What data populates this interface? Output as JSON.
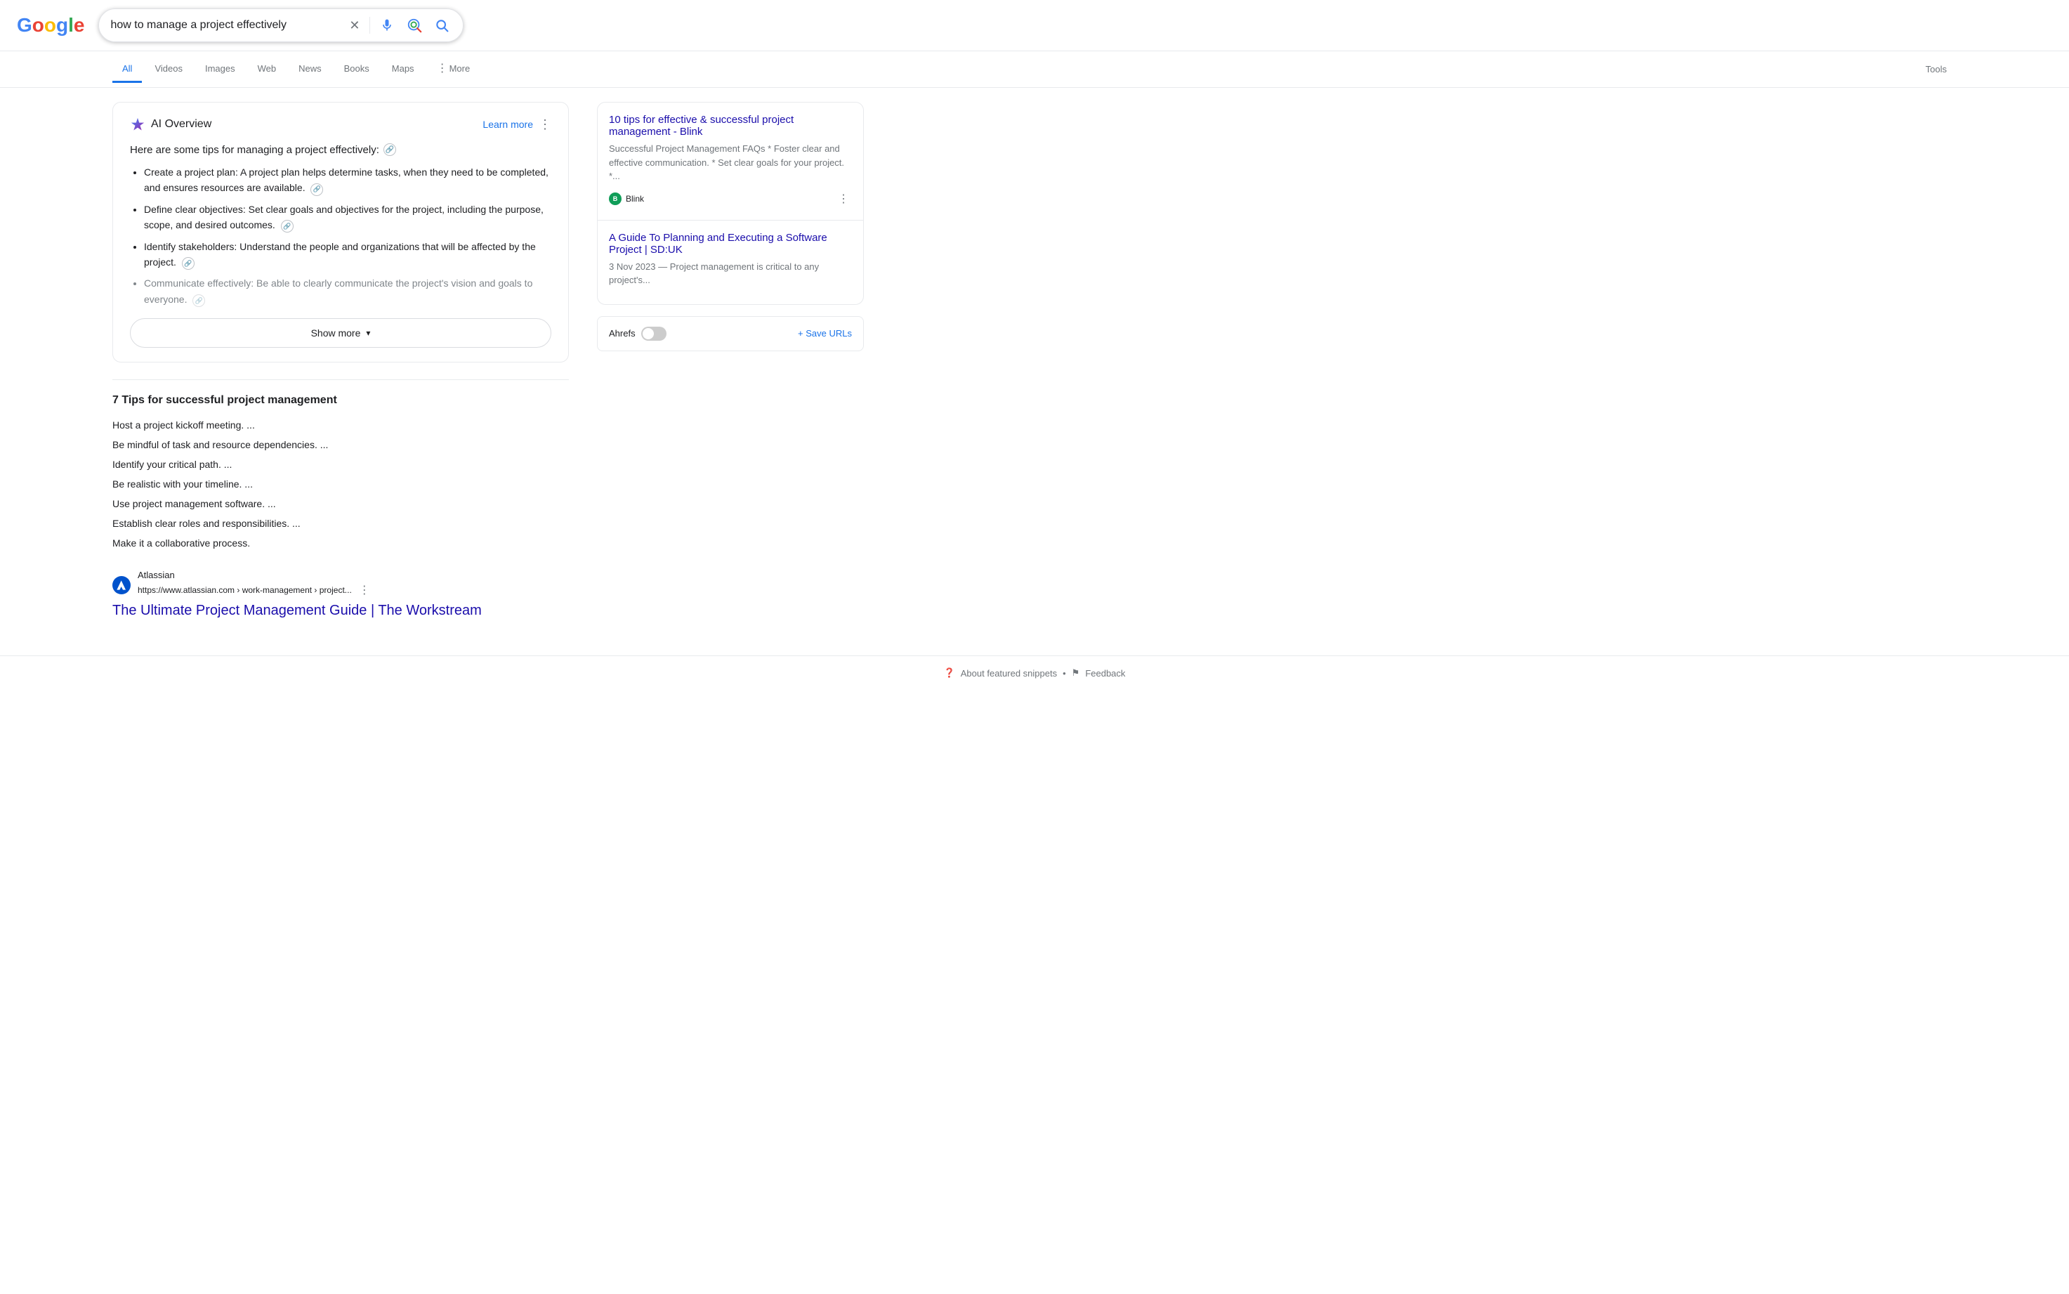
{
  "header": {
    "logo_letters": [
      "G",
      "o",
      "o",
      "g",
      "l",
      "e"
    ],
    "search_value": "how to manage a project effectively",
    "clear_title": "Clear",
    "mic_title": "Search by voice",
    "lens_title": "Search by image",
    "search_title": "Google Search"
  },
  "nav": {
    "tabs": [
      {
        "label": "All",
        "active": true
      },
      {
        "label": "Videos",
        "active": false
      },
      {
        "label": "Images",
        "active": false
      },
      {
        "label": "Web",
        "active": false
      },
      {
        "label": "News",
        "active": false
      },
      {
        "label": "Books",
        "active": false
      },
      {
        "label": "Maps",
        "active": false
      },
      {
        "label": "More",
        "active": false
      }
    ],
    "tools_label": "Tools"
  },
  "ai_overview": {
    "title": "AI Overview",
    "learn_more": "Learn more",
    "intro": "Here are some tips for managing a project effectively:",
    "items": [
      {
        "text": "Create a project plan: A project plan helps determine tasks, when they need to be completed, and ensures resources are available.",
        "faded": false
      },
      {
        "text": "Define clear objectives: Set clear goals and objectives for the project, including the purpose, scope, and desired outcomes.",
        "faded": false
      },
      {
        "text": "Identify stakeholders: Understand the people and organizations that will be affected by the project.",
        "faded": false
      },
      {
        "text": "Communicate effectively: Be able to clearly communicate the project's vision and goals to everyone.",
        "faded": true
      }
    ],
    "show_more_label": "Show more"
  },
  "featured_snippet": {
    "title": "7 Tips for successful project management",
    "items": [
      "1.  Host a project kickoff meeting. ...",
      "2.  Be mindful of task and resource dependencies. ...",
      "3.  Identify your critical path. ...",
      "4.  Be realistic with your timeline. ...",
      "5.  Use project management software. ...",
      "6.  Establish clear roles and responsibilities. ...",
      "7.  Make it a collaborative process."
    ]
  },
  "source_result": {
    "favicon_letter": "A",
    "source_name": "Atlassian",
    "source_url": "https://www.atlassian.com › work-management › project...",
    "result_title": "The Ultimate Project Management Guide | The Workstream"
  },
  "right_panel": {
    "cards": [
      {
        "title": "10 tips for effective & successful project management - Blink",
        "description": "Successful Project Management FAQs * Foster clear and effective communication. * Set clear goals for your project. *...",
        "source_name": "Blink",
        "favicon_letter": "B",
        "favicon_color": "#0F9D58"
      },
      {
        "title": "A Guide To Planning and Executing a Software Project | SD:UK",
        "description": "3 Nov 2023 — Project management is critical to any project's...",
        "source_name": "",
        "favicon_letter": "",
        "favicon_color": ""
      }
    ]
  },
  "ahrefs_widget": {
    "label": "Ahrefs",
    "save_urls_label": "+ Save URLs"
  },
  "footer": {
    "about_label": "About featured snippets",
    "feedback_label": "Feedback"
  }
}
